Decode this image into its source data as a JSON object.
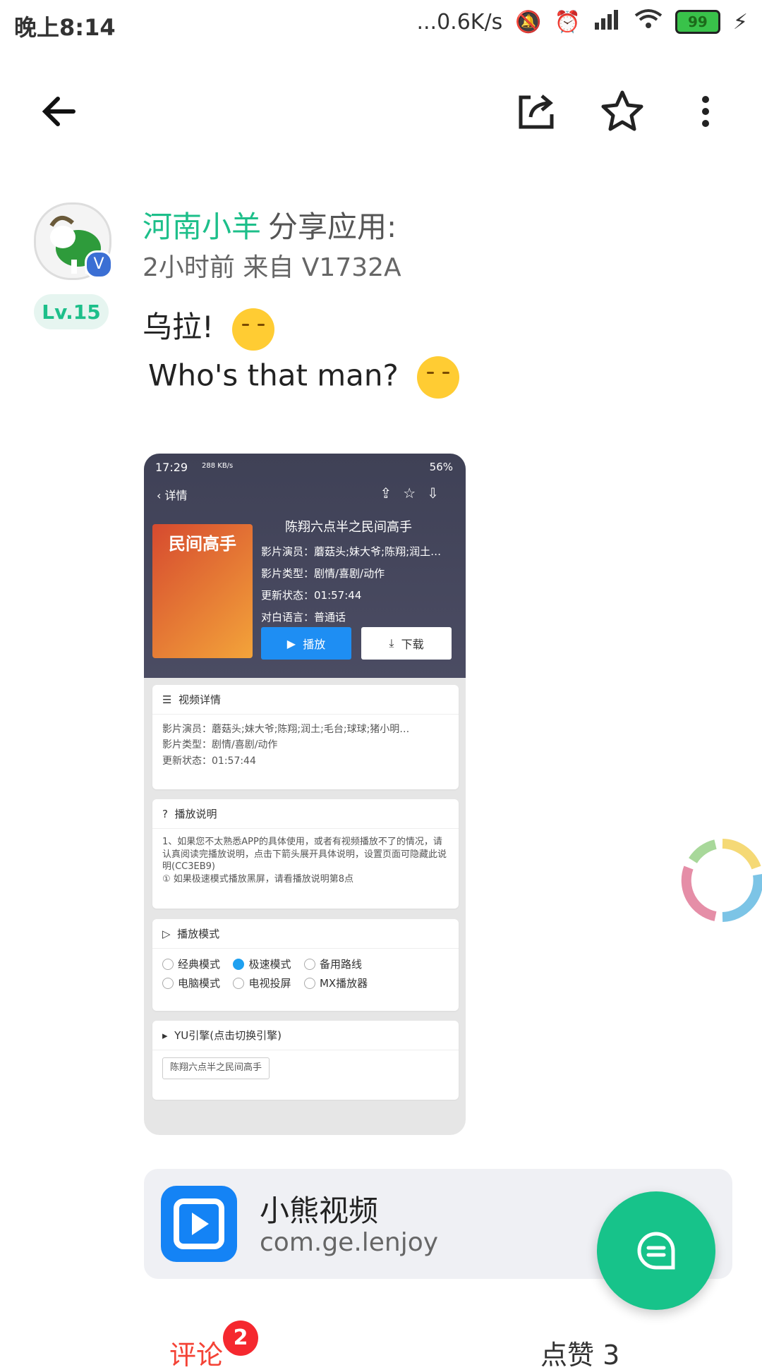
{
  "status_bar": {
    "time": "晚上8:14",
    "net_speed": "...0.6K/s",
    "battery": "99"
  },
  "post": {
    "author": "河南小羊",
    "action": "分享应用:",
    "meta": "2小时前   来自 V1732A",
    "level": "Lv.15",
    "text_line1": "乌拉!",
    "text_line2": " Who's that man?"
  },
  "screenshot": {
    "time": "17:29",
    "speed": "288 KB/s",
    "battery": "56%",
    "nav_title": "详情",
    "movie_title": "陈翔六点半之民间高手",
    "poster_text": "民间高手",
    "info": [
      "影片演员：蘑菇头;妹大爷;陈翔;润土…",
      "影片类型：剧情/喜剧/动作",
      "更新状态：01:57:44",
      "对白语言：普通话"
    ],
    "play_label": "播放",
    "download_label": "下载",
    "details_header": "视频详情",
    "details": [
      "影片演员：蘑菇头;妹大爷;陈翔;润土;毛台;球球;猪小明…",
      "影片类型：剧情/喜剧/动作",
      "更新状态：01:57:44"
    ],
    "help_header": "播放说明",
    "help_text": "1、如果您不太熟悉APP的具体使用，或者有视频播放不了的情况，请认真阅读完播放说明，点击下箭头展开具体说明，设置页面可隐藏此说明(CC3EB9)",
    "help_note": "① 如果极速模式播放黑屏，请看播放说明第8点",
    "mode_header": "播放模式",
    "modes": [
      "经典模式",
      "极速模式",
      "备用路线",
      "电脑模式",
      "电视投屏",
      "MX播放器"
    ],
    "engine_header": "YU引擎(点击切换引擎)",
    "episode_chip": "陈翔六点半之民间高手"
  },
  "app_card": {
    "name": "小熊视频",
    "package": "com.ge.lenjoy"
  },
  "tabs": {
    "comments_label": "评论",
    "comments_badge": "2",
    "likes_label": "点赞 3"
  },
  "colors": {
    "accent": "#1dbf8a",
    "badge": "#f5282f",
    "app_icon": "#1483f5"
  }
}
